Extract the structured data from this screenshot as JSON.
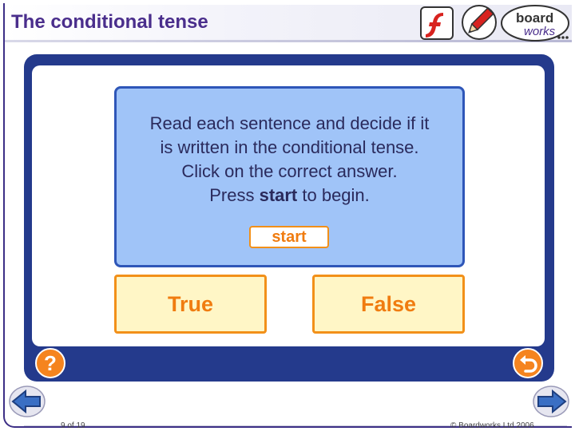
{
  "header": {
    "title": "The conditional tense",
    "logo_top": "board",
    "logo_bottom": "works"
  },
  "icons": {
    "flash": "flash-icon",
    "pencil": "pencil-icon",
    "help": "question-icon",
    "reset": "undo-icon",
    "back": "back-arrow-icon",
    "forward": "forward-arrow-icon"
  },
  "panel": {
    "line1": "Read each sentence and decide if it",
    "line2": "is written in the conditional tense.",
    "line3": "Click on the correct answer.",
    "line4_prefix": "Press ",
    "line4_bold": "start",
    "line4_suffix": " to begin.",
    "start_label": "start"
  },
  "answers": {
    "true_label": "True",
    "false_label": "False"
  },
  "controls": {
    "help_label": "?"
  },
  "footer": {
    "slide_counter": "9 of 19",
    "copyright": "© Boardworks Ltd 2006"
  },
  "colors": {
    "title": "#4a2e8c",
    "frame": "#243a8c",
    "panel": "#a0c4f8",
    "panel_border": "#2e56b8",
    "accent_orange": "#f29019",
    "answer_bg": "#fff6c6"
  }
}
